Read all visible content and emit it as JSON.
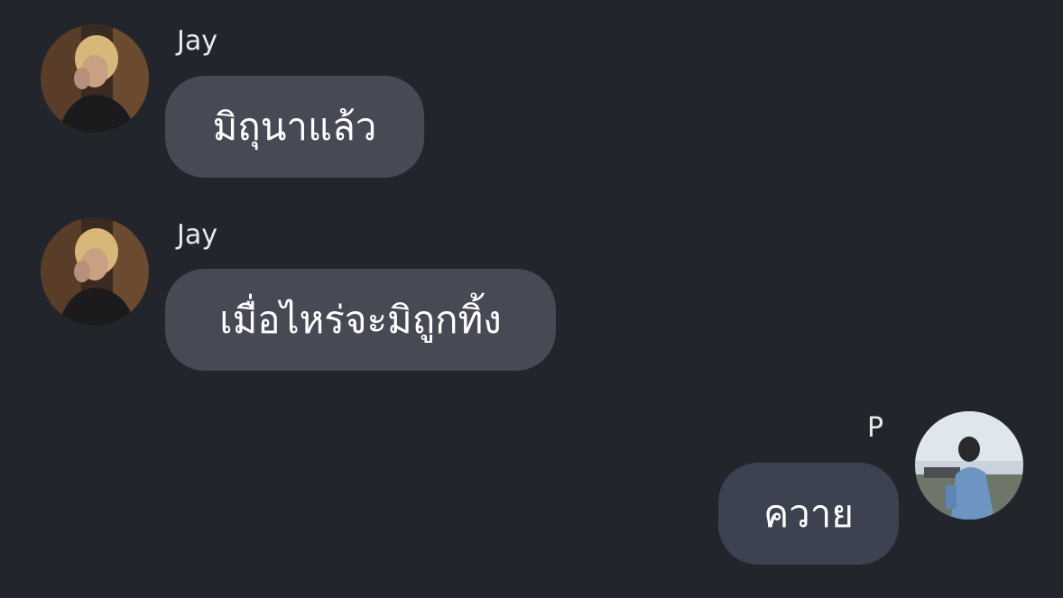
{
  "messages": [
    {
      "direction": "incoming",
      "sender": "Jay",
      "text": "มิถุนาแล้ว",
      "avatar_icon": "jay-profile-photo"
    },
    {
      "direction": "incoming",
      "sender": "Jay",
      "text": "เมื่อไหร่จะมิถูกทิ้ง",
      "avatar_icon": "jay-profile-photo"
    },
    {
      "direction": "outgoing",
      "sender": "P",
      "text": "ควาย",
      "avatar_icon": "p-profile-photo"
    }
  ],
  "colors": {
    "background": "#23252d",
    "incoming_bubble": "#474a55",
    "outgoing_bubble": "#3c4250",
    "text": "#ffffff",
    "sender_name": "#e9eaee"
  }
}
